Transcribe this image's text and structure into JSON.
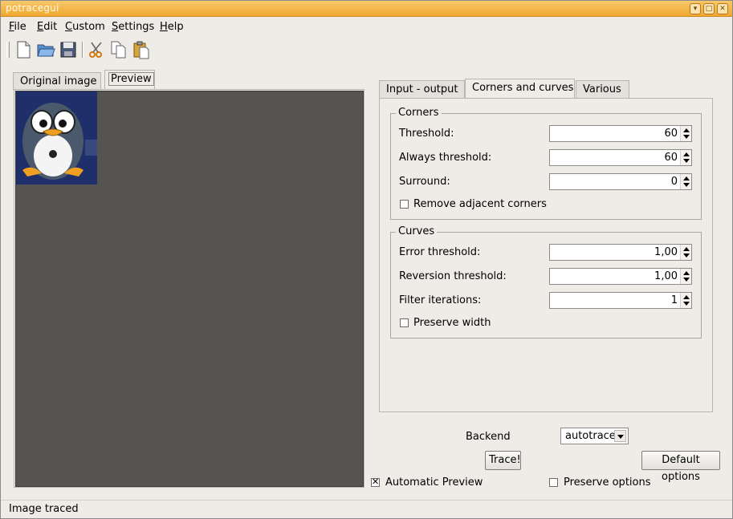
{
  "window": {
    "title": "potracegui"
  },
  "menu": [
    {
      "label": "File"
    },
    {
      "label": "Edit"
    },
    {
      "label": "Custom"
    },
    {
      "label": "Settings"
    },
    {
      "label": "Help"
    }
  ],
  "toolbar_icons": [
    "new-file-icon",
    "open-folder-icon",
    "save-disk-icon",
    "cut-scissors-icon",
    "copy-icon",
    "paste-icon"
  ],
  "left_tabs": {
    "original": "Original image",
    "preview": "Preview"
  },
  "right_tabs": {
    "io": "Input - output",
    "corners": "Corners and curves",
    "various": "Various"
  },
  "corners": {
    "title": "Corners",
    "threshold_label": "Threshold:",
    "threshold_value": "60",
    "always_label": "Always threshold:",
    "always_value": "60",
    "surround_label": "Surround:",
    "surround_value": "0",
    "remove_adjacent_label": "Remove adjacent corners",
    "remove_adjacent_checked": false
  },
  "curves": {
    "title": "Curves",
    "error_label": "Error threshold:",
    "error_value": "1,00",
    "reversion_label": "Reversion threshold:",
    "reversion_value": "1,00",
    "filter_label": "Filter iterations:",
    "filter_value": "1",
    "preserve_width_label": "Preserve width",
    "preserve_width_checked": false
  },
  "bottom": {
    "backend_label": "Backend",
    "backend_value": "autotrace",
    "trace_button": "Trace!",
    "default_options_button": "Default options",
    "auto_preview_label": "Automatic Preview",
    "auto_preview_checked": true,
    "preserve_options_label": "Preserve options",
    "preserve_options_checked": false
  },
  "status": {
    "text": "Image traced"
  },
  "colors": {
    "titlebar": "#f0a830",
    "canvas": "#555452",
    "window_bg": "#efebe7"
  }
}
